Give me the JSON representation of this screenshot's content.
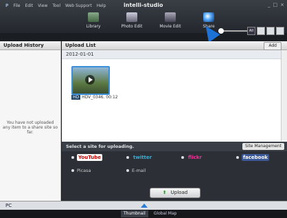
{
  "menu": {
    "items": [
      "File",
      "Edit",
      "View",
      "Tool",
      "Web Support",
      "Help"
    ]
  },
  "app_title": "intelli-studio",
  "tabs": [
    {
      "label": "Library"
    },
    {
      "label": "Photo Edit"
    },
    {
      "label": "Movie Edit"
    },
    {
      "label": "Share"
    }
  ],
  "view_buttons": [
    "All",
    "",
    "",
    ""
  ],
  "left_panel": {
    "title": "Upload History",
    "message": "You have not uploaded any item to a share site so far."
  },
  "main": {
    "title": "Upload List",
    "add_label": "Add",
    "date": "2012-01-01",
    "item": {
      "badge": "HD",
      "filename": "HDV_0346.",
      "duration": "00:12"
    }
  },
  "share": {
    "prompt": "Select a site for uploading.",
    "site_mgmt": "Site Management",
    "sites": [
      {
        "name": "YouTube"
      },
      {
        "name": "twitter"
      },
      {
        "name": "flickr"
      },
      {
        "name": "facebook"
      },
      {
        "name": "Picasa"
      },
      {
        "name": "E-mail"
      }
    ],
    "upload": "Upload"
  },
  "bottom": {
    "pc": "PC"
  },
  "footer": {
    "tabs": [
      "Thumbnail",
      "Global Map"
    ]
  }
}
